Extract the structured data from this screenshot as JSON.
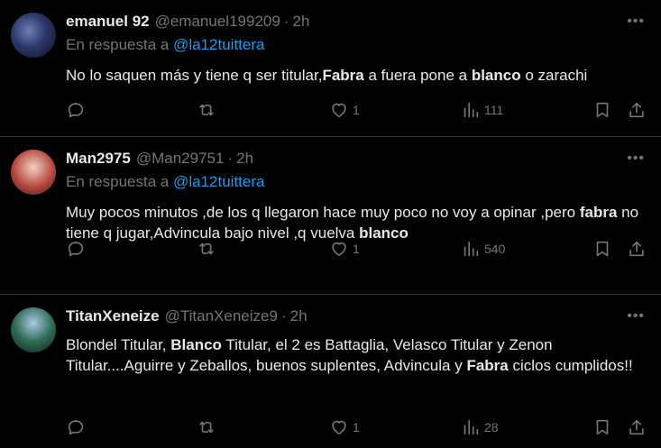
{
  "tweets": [
    {
      "name": "emanuel 92",
      "handle": "@emanuel199209",
      "separator": "·",
      "time": "2h",
      "reply_prefix": "En respuesta a",
      "reply_to": "@la12tuittera",
      "text_parts": [
        {
          "t": "No lo saquen más y tiene q ser titular,",
          "b": false
        },
        {
          "t": "Fabra",
          "b": true
        },
        {
          "t": " a fuera pone a ",
          "b": false
        },
        {
          "t": "blanco",
          "b": true
        },
        {
          "t": " o zarachi",
          "b": false
        }
      ],
      "likes": "1",
      "views": "111"
    },
    {
      "name": "Man2975",
      "handle": "@Man29751",
      "separator": "·",
      "time": "2h",
      "reply_prefix": "En respuesta a",
      "reply_to": "@la12tuittera",
      "text_parts": [
        {
          "t": "Muy pocos minutos ,de los q llegaron hace muy poco no voy a opinar ,pero ",
          "b": false
        },
        {
          "t": "fabra",
          "b": true
        },
        {
          "t": " no tiene q jugar,Advincula bajo nivel ,q vuelva ",
          "b": false
        },
        {
          "t": "blanco",
          "b": true
        }
      ],
      "likes": "1",
      "views": "540"
    },
    {
      "name": "TitanXeneize",
      "handle": "@TitanXeneize9",
      "separator": "·",
      "time": "2h",
      "text_parts": [
        {
          "t": "Blondel Titular, ",
          "b": false
        },
        {
          "t": "Blanco",
          "b": true
        },
        {
          "t": " Titular, el 2 es Battaglia, Velasco Titular y Zenon Titular....Aguirre y Zeballos, buenos suplentes, Advincula y ",
          "b": false
        },
        {
          "t": "Fabra",
          "b": true
        },
        {
          "t": " ciclos cumplidos!!",
          "b": false
        }
      ],
      "likes": "1",
      "views": "28"
    }
  ],
  "icons": {
    "more": "more-horizontal-icon",
    "reply": "reply-bubble-icon",
    "retweet": "retweet-icon",
    "like": "heart-icon",
    "views": "views-chart-icon",
    "bookmark": "bookmark-icon",
    "share": "share-upload-icon"
  },
  "colors": {
    "background": "#000000",
    "text": "#e7e9ea",
    "muted": "#71767b",
    "link": "#1d9bf0",
    "divider": "#2f3336"
  }
}
